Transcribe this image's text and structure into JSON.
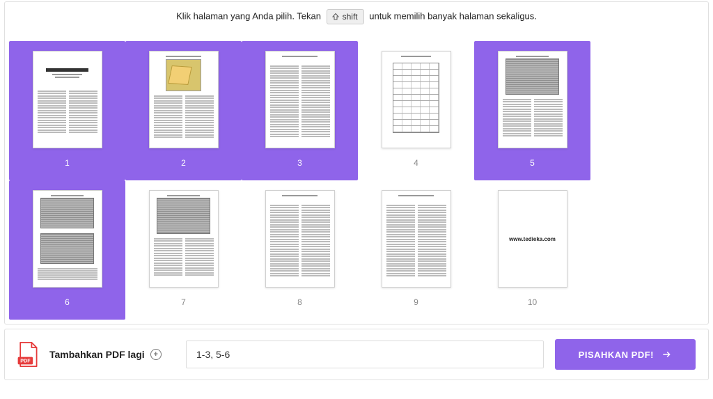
{
  "hint": {
    "before_key": "Klik halaman yang Anda pilih. Tekan",
    "key_label": "shift",
    "after_key": "untuk memilih banyak halaman sekaligus."
  },
  "pages": [
    {
      "num": "1",
      "selected": true,
      "kind": "title"
    },
    {
      "num": "2",
      "selected": true,
      "kind": "map"
    },
    {
      "num": "3",
      "selected": true,
      "kind": "text2"
    },
    {
      "num": "4",
      "selected": false,
      "kind": "table"
    },
    {
      "num": "5",
      "selected": true,
      "kind": "seismic1"
    },
    {
      "num": "6",
      "selected": true,
      "kind": "seismic2"
    },
    {
      "num": "7",
      "selected": false,
      "kind": "seismic1"
    },
    {
      "num": "8",
      "selected": false,
      "kind": "text2"
    },
    {
      "num": "9",
      "selected": false,
      "kind": "text2"
    },
    {
      "num": "10",
      "selected": false,
      "kind": "brand",
      "brand": "www.tedieka.com"
    }
  ],
  "bottom": {
    "add_label": "Tambahkan PDF lagi",
    "range_value": "1-3, 5-6",
    "split_label": "PISAHKAN PDF!"
  },
  "colors": {
    "accent": "#8f64ea"
  }
}
